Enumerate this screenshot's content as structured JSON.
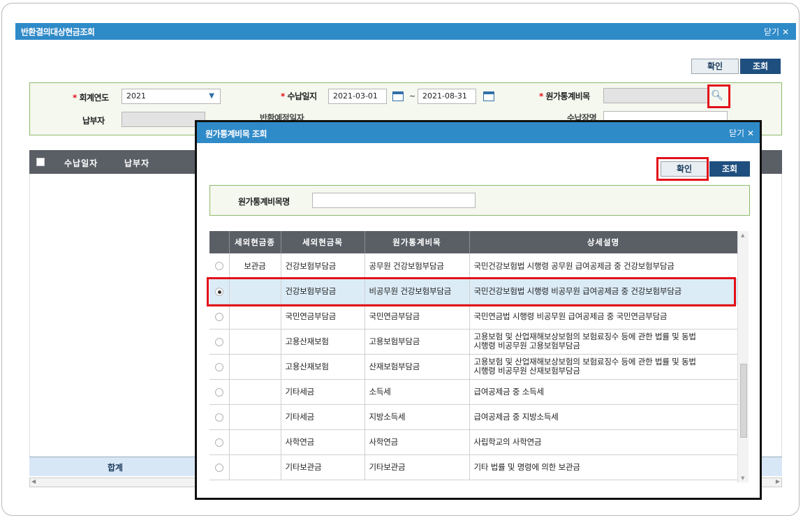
{
  "outer": {
    "title": "반환결의대상현금조회",
    "close_label": "닫기",
    "confirm_label": "확인",
    "search_label": "조회",
    "filters": {
      "fiscal_year_label": "회계연도",
      "fiscal_year_value": "2021",
      "receipt_date_label": "수납일지",
      "receipt_date_from": "2021-03-01",
      "receipt_date_sep": "~",
      "receipt_date_to": "2021-08-31",
      "cost_item_label": "원가통계비목",
      "payer_label": "납부자",
      "return_date_label": "반환예정일자",
      "receipt_place_label": "수납장명"
    },
    "grid": {
      "columns": [
        "수납일자",
        "납부자"
      ],
      "sum_label": "합계"
    }
  },
  "modal": {
    "title": "원가통계비목 조회",
    "close_label": "닫기",
    "confirm_label": "확인",
    "search_label": "조회",
    "name_field_label": "원가통계비목명",
    "columns": [
      "세외현금종",
      "세외현금목",
      "원가통계비목",
      "상세설명"
    ],
    "rows": [
      {
        "kind": "보관금",
        "item": "건강보험부담금",
        "cost": "공무원 건강보험부담금",
        "desc": "국민건강보험법 시행령 공무원 급여공제금 중 건강보험부담금",
        "desc2": ""
      },
      {
        "kind": "",
        "item": "건강보험부담금",
        "cost": "비공무원 건강보험부담금",
        "desc": "국민건강보험법 시행령 비공무원 급여공제금 중 건강보험부담금",
        "desc2": ""
      },
      {
        "kind": "",
        "item": "국민연금부담금",
        "cost": "국민연금부담금",
        "desc": "국민연금법 시행령 비공무원 급여공제금 중 국민연금부담금",
        "desc2": ""
      },
      {
        "kind": "",
        "item": "고용산재보험",
        "cost": "고용보험부담금",
        "desc": "고용보험 및 산업재해보상보험의 보험료징수 등에 관한 법률 및 동법",
        "desc2": "시행령 비공무원 고용보험부담금"
      },
      {
        "kind": "",
        "item": "고용산재보험",
        "cost": "산재보험부담금",
        "desc": "고용보험 및 산업재해보상보험의 보험료징수 등에 관한 법률 및 동법",
        "desc2": "시행령 비공무원 산재보험부담금"
      },
      {
        "kind": "",
        "item": "기타세금",
        "cost": "소득세",
        "desc": "급여공제금 중 소득세",
        "desc2": ""
      },
      {
        "kind": "",
        "item": "기타세금",
        "cost": "지방소득세",
        "desc": "급여공제금 중 지방소득세",
        "desc2": ""
      },
      {
        "kind": "",
        "item": "사학연금",
        "cost": "사학연금",
        "desc": "사립학교의 사학연금",
        "desc2": ""
      },
      {
        "kind": "",
        "item": "기타보관금",
        "cost": "기타보관금",
        "desc": "기타 법률 및 명령에 의한 보관금",
        "desc2": ""
      }
    ],
    "selected_row": 1
  }
}
